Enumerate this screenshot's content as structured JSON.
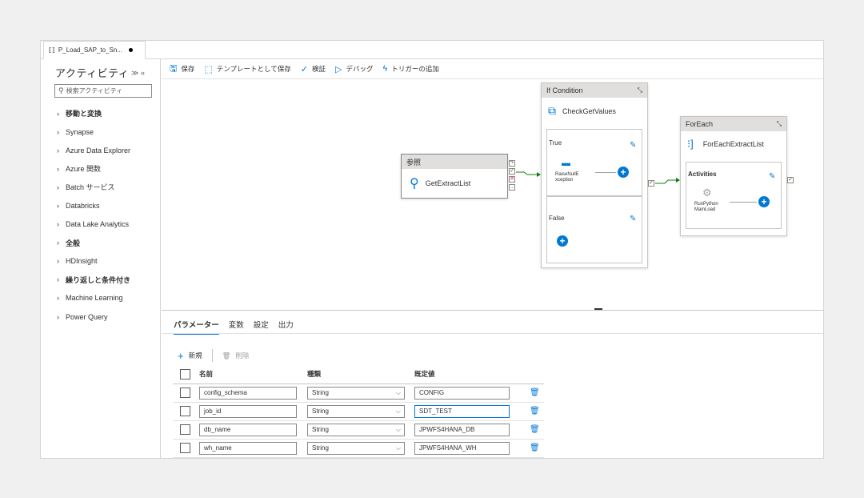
{
  "tab": {
    "title": "P_Load_SAP_to_Sn..."
  },
  "sidebar": {
    "title": "アクティビティ",
    "controls": "«",
    "collapse_all": "»",
    "search_placeholder": "検索アクティビティ",
    "items": [
      {
        "label": "移動と変換"
      },
      {
        "label": "Synapse"
      },
      {
        "label": "Azure Data Explorer"
      },
      {
        "label": "Azure 関数"
      },
      {
        "label": "Batch サービス"
      },
      {
        "label": "Databricks"
      },
      {
        "label": "Data Lake Analytics"
      },
      {
        "label": "全般"
      },
      {
        "label": "HDInsight"
      },
      {
        "label": "繰り返しと条件付き"
      },
      {
        "label": "Machine Learning"
      },
      {
        "label": "Power Query"
      }
    ]
  },
  "toolbar": {
    "save": "保存",
    "save_as_template": "テンプレートとして保存",
    "validate": "検証",
    "debug": "デバッグ",
    "add_trigger": "トリガーの追加"
  },
  "canvas": {
    "lookup": {
      "type": "参照",
      "name": "GetExtractList"
    },
    "if_condition": {
      "type": "If Condition",
      "name": "CheckGetValues",
      "true_label": "True",
      "true_activity": "RaiseNullE xception",
      "false_label": "False"
    },
    "foreach": {
      "type": "ForEach",
      "name": "ForEachExtractList",
      "activities_label": "Activities",
      "inner_activity": "RunPython MainLoad"
    }
  },
  "bottom": {
    "tabs": [
      "パラメーター",
      "変数",
      "設定",
      "出力"
    ],
    "new": "新規",
    "delete": "削除",
    "columns": {
      "name": "名前",
      "type": "種類",
      "default": "既定値"
    },
    "rows": [
      {
        "name": "config_schema",
        "type": "String",
        "default": "CONFIG"
      },
      {
        "name": "job_id",
        "type": "String",
        "default": "SDT_TEST"
      },
      {
        "name": "db_name",
        "type": "String",
        "default": "JPWFS4HANA_DB"
      },
      {
        "name": "wh_name",
        "type": "String",
        "default": "JPWFS4HANA_WH"
      }
    ]
  },
  "colors": {
    "accent": "#0078d4",
    "success": "#107c10",
    "error": "#d13438"
  },
  "icons": {
    "pipeline": "pipeline-icon",
    "search": "search-icon",
    "save": "save-icon",
    "template": "template-icon",
    "validate": "check-icon",
    "debug": "play-icon",
    "trigger": "trigger-icon",
    "edit": "pencil-icon",
    "add": "plus-icon",
    "trash": "trash-icon"
  }
}
